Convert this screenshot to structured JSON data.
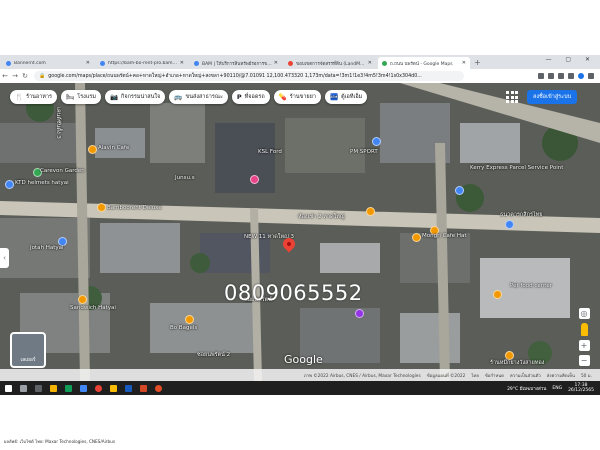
{
  "browser": {
    "tabs": [
      {
        "label": "Bannernt.com",
        "active": false
      },
      {
        "label": "https://bam-bo-rent-pro.bam.co...",
        "active": false
      },
      {
        "label": "BAM | ให้บริการสินทรัพย์รอการขาย...",
        "active": false
      },
      {
        "label": "ขอบเขตการจัดสรรที่ดิน (LandMap)",
        "active": false
      },
      {
        "label": "ถ.ถนน นพรัตน์ - Google Maps",
        "active": true
      }
    ],
    "url": "google.com/maps/place/ถนนพรัตน์+คอ+หาดใหญ่+อำเภอ+หาดใหญ่+สงขลา+90110/@7.01091 12,100.473320 1,173m/data=!3m1!1e3!4m5!3m4!1s0x304d0...",
    "new_tab_symbol": "+",
    "window_controls": "— ▢ ✕"
  },
  "map": {
    "categories": [
      {
        "label": "ร้านอาหาร",
        "icon": "fork-knife-icon"
      },
      {
        "label": "โรงแรม",
        "icon": "bed-icon"
      },
      {
        "label": "กิจกรรมน่าสนใจ",
        "icon": "camera-icon"
      },
      {
        "label": "ขนส่งสาธารณะ",
        "icon": "bus-icon"
      },
      {
        "label": "ที่จอดรถ",
        "icon": "parking-icon"
      },
      {
        "label": "ร้านขายยา",
        "icon": "pill-icon"
      },
      {
        "label": "ตู้เอทีเอ็ม",
        "icon": "atm-icon"
      }
    ],
    "sign_in_label": "ลงชื่อเข้าสู่ระบบ",
    "phone_overlay": "0809065552",
    "google_logo": "Google",
    "layers_label": "เลเยอร์",
    "places": [
      {
        "name": "เคนต์ซันตั้ง 3"
      },
      {
        "name": "Alavin Cafe"
      },
      {
        "name": "Carevon Garden"
      },
      {
        "name": "KTD helmets hatyai"
      },
      {
        "name": "Bamboorent Deluxe"
      },
      {
        "name": "Junsu.s"
      },
      {
        "name": "KSL Ford"
      },
      {
        "name": "PM SPORT"
      },
      {
        "name": "ห้องเช่า 2 หาดใหญ่"
      },
      {
        "name": "Kerry Express Parcel Service Point"
      },
      {
        "name": "ธนาคารกสิกรไทย"
      },
      {
        "name": "Mongri Cafe Hat"
      },
      {
        "name": "NEW 11 หาดใหญ่ 3"
      },
      {
        "name": "Jotah Hatyai"
      },
      {
        "name": "ซอยนพรัตน์"
      },
      {
        "name": "Sandwich Hatyai"
      },
      {
        "name": "Bo Bagels"
      },
      {
        "name": "ซอยนพรัตน์ 2"
      },
      {
        "name": "Pet food center"
      },
      {
        "name": "ร้านหมึกย่างวังสายทอง"
      }
    ],
    "footer": [
      "ภาพ ©2022 Airbus, CNES / Airbus, Maxar Technologies",
      "ข้อมูลแผนที่ ©2022",
      "ไทย",
      "ข้อกำหนด",
      "ความเป็นส่วนตัว",
      "ส่งความคิดเห็น",
      "50 ม."
    ]
  },
  "taskbar": {
    "weather": "29°C มีเมฆบางส่วน",
    "time": "17:38",
    "date": "26/12/2565",
    "lang": "ENG"
  },
  "caption": "ผลลัพธ์: เว็บไซต์ ไทย: Maxar Technologies, CNES/Airbus"
}
